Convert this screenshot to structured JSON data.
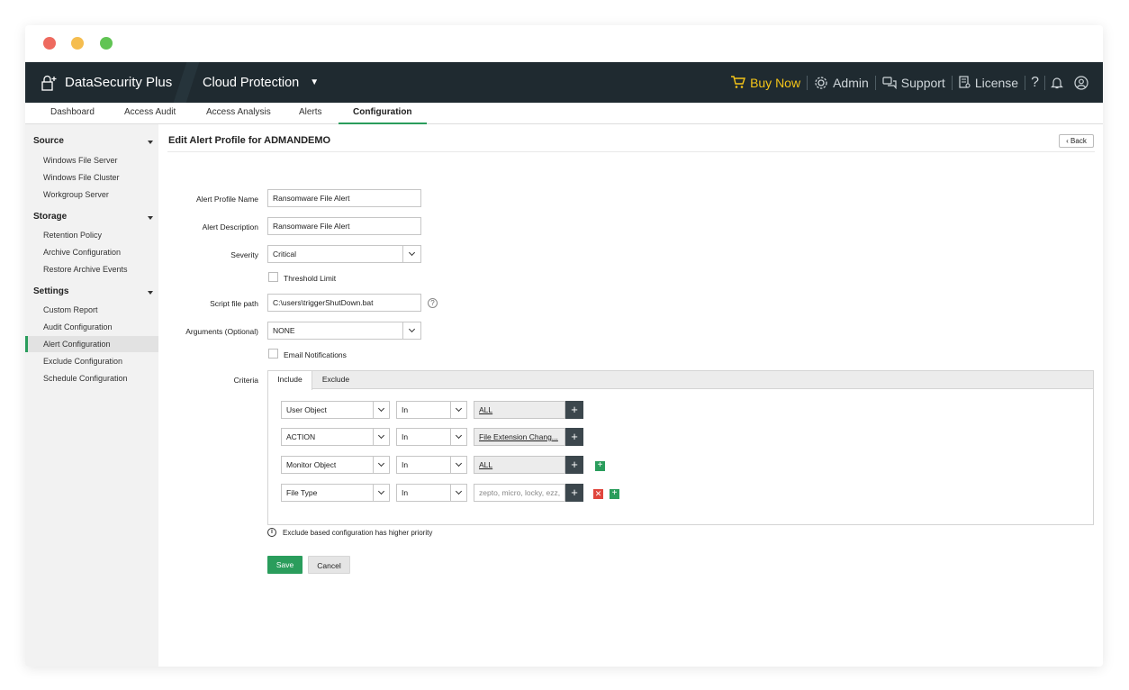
{
  "window": {
    "traffic_lights": [
      "close",
      "minimize",
      "maximize"
    ]
  },
  "topbar": {
    "brand": "DataSecurity Plus",
    "module": "Cloud Protection",
    "buy_now": "Buy Now",
    "admin": "Admin",
    "support": "Support",
    "license": "License",
    "help": "?",
    "colors": {
      "bg": "#1f2a30",
      "buy": "#f5c518"
    }
  },
  "nav": {
    "tabs": [
      "Dashboard",
      "Access Audit",
      "Access Analysis",
      "Alerts",
      "Configuration"
    ],
    "active": "Configuration"
  },
  "sidebar": {
    "sections": [
      {
        "title": "Source",
        "items": [
          "Windows File Server",
          "Windows File Cluster",
          "Workgroup Server"
        ]
      },
      {
        "title": "Storage",
        "items": [
          "Retention Policy",
          "Archive Configuration",
          "Restore Archive Events"
        ]
      },
      {
        "title": "Settings",
        "items": [
          "Custom Report",
          "Audit Configuration",
          "Alert Configuration",
          "Exclude Configuration",
          "Schedule Configuration"
        ]
      }
    ],
    "active_item": "Alert Configuration"
  },
  "page": {
    "title": "Edit Alert Profile for ADMANDEMO",
    "back_label": "Back"
  },
  "form": {
    "profile_name_label": "Alert Profile Name",
    "profile_name_value": "Ransomware File Alert",
    "description_label": "Alert Description",
    "description_value": "Ransomware File Alert",
    "severity_label": "Severity",
    "severity_value": "Critical",
    "threshold_label": "Threshold Limit",
    "threshold_checked": false,
    "script_label": "Script file path",
    "script_value": "C:\\users\\triggerShutDown.bat",
    "arguments_label": "Arguments (Optional)",
    "arguments_value": "NONE",
    "email_label": "Email Notifications",
    "email_checked": false,
    "criteria_label": "Criteria"
  },
  "criteria": {
    "tabs": [
      "Include",
      "Exclude"
    ],
    "active_tab": "Include",
    "rows": [
      {
        "field": "User Object",
        "operator": "In",
        "value": "ALL",
        "is_placeholder": false,
        "add": false,
        "remove": false
      },
      {
        "field": "ACTION",
        "operator": "In",
        "value": "File Extension Chang...",
        "is_placeholder": false,
        "add": false,
        "remove": false
      },
      {
        "field": "Monitor Object",
        "operator": "In",
        "value": "ALL",
        "is_placeholder": false,
        "add": true,
        "remove": false
      },
      {
        "field": "File Type",
        "operator": "In",
        "value": "zepto, micro, locky, ezz,",
        "is_placeholder": true,
        "add": true,
        "remove": true
      }
    ],
    "note": "Exclude based configuration has higher priority"
  },
  "actions": {
    "save": "Save",
    "cancel": "Cancel",
    "save_color": "#2a9d5c"
  }
}
